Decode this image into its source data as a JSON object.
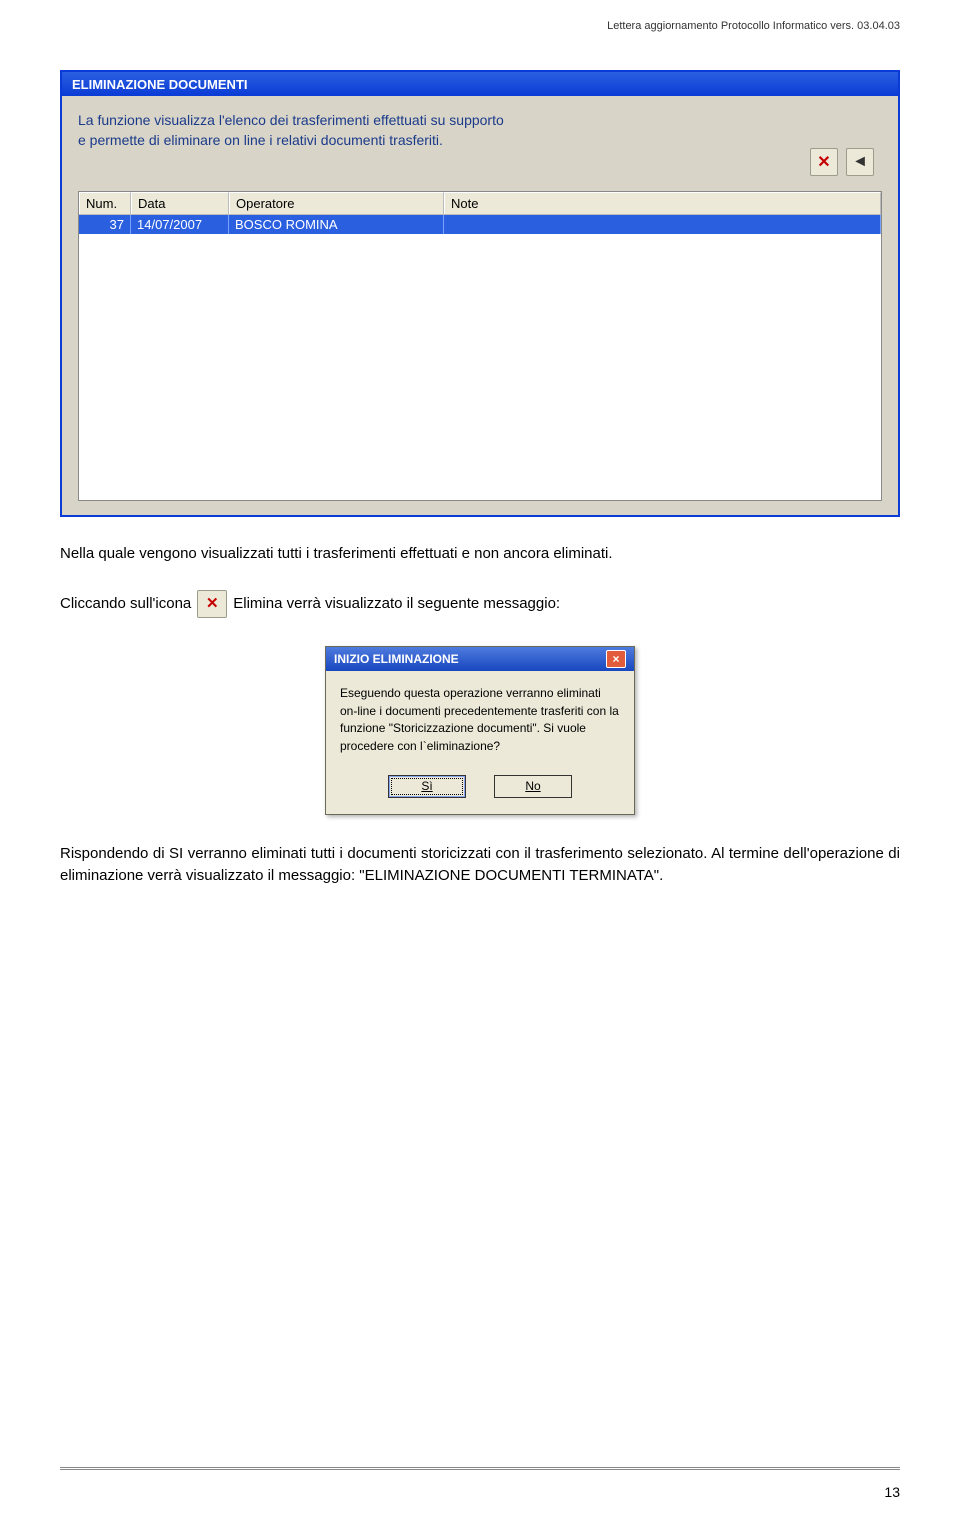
{
  "header": {
    "doc_ref": "Lettera aggiornamento Protocollo Informatico vers. 03.04.03"
  },
  "window1": {
    "title": "ELIMINAZIONE DOCUMENTI",
    "desc_line1": "La funzione visualizza l'elenco dei trasferimenti effettuati su supporto",
    "desc_line2": "e permette di eliminare on line i relativi documenti trasferiti.",
    "columns": {
      "num": "Num.",
      "data": "Data",
      "operatore": "Operatore",
      "note": "Note"
    },
    "row": {
      "num": "37",
      "data": "14/07/2007",
      "operatore": "BOSCO ROMINA",
      "note": ""
    },
    "icons": {
      "delete": "✕",
      "back": "◄"
    }
  },
  "para1": "Nella quale vengono visualizzati tutti i trasferimenti effettuati e non ancora eliminati.",
  "para2_pre": "Cliccando sull'icona",
  "para2_post": "Elimina verrà visualizzato il seguente messaggio:",
  "inline_icon": "✕",
  "dialog": {
    "title": "INIZIO ELIMINAZIONE",
    "body": "Eseguendo questa operazione verranno eliminati on-line i documenti precedentemente trasferiti con la funzione \"Storicizzazione documenti\". Si vuole procedere con l`eliminazione?",
    "btn_yes": "Sì",
    "btn_no": "No",
    "close": "×"
  },
  "para3": "Rispondendo di SI verranno eliminati tutti i documenti storicizzati con il trasferimento selezionato. Al termine dell'operazione di eliminazione verrà visualizzato il messaggio: \"ELIMINAZIONE DOCUMENTI TERMINATA\".",
  "page_number": "13"
}
